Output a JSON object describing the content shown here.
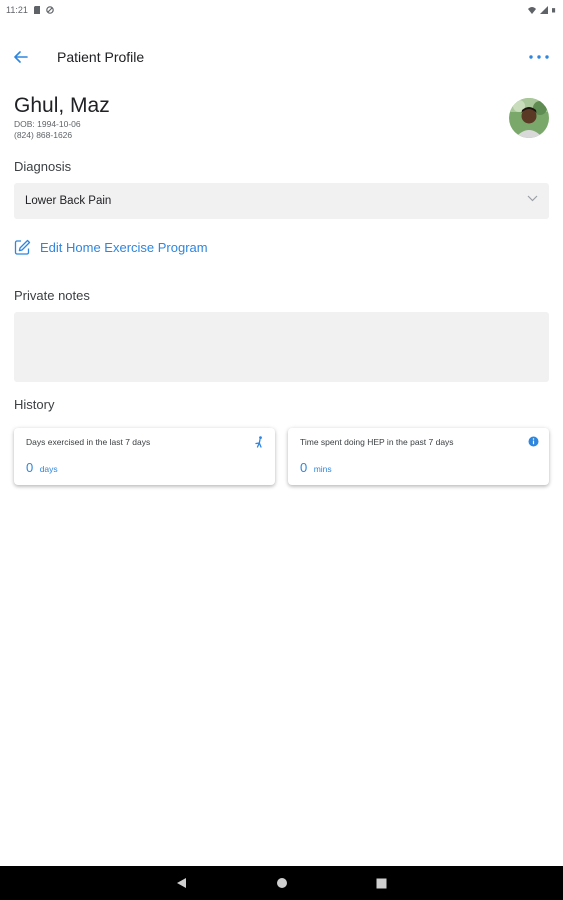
{
  "status_bar": {
    "time": "11:21"
  },
  "app_bar": {
    "title": "Patient Profile",
    "back_icon": "arrow-back-icon",
    "more_icon": "more-horizontal-icon"
  },
  "patient": {
    "name": "Ghul, Maz",
    "dob": "DOB: 1994-10-06",
    "phone": "(824) 868-1626"
  },
  "diagnosis": {
    "label": "Diagnosis",
    "selected": "Lower Back Pain"
  },
  "edit_hep": {
    "label": "Edit Home Exercise Program",
    "icon": "edit-icon"
  },
  "private_notes": {
    "label": "Private notes",
    "value": ""
  },
  "history": {
    "label": "History",
    "cards": [
      {
        "title": "Days exercised in the last 7 days",
        "value": "0",
        "unit": "days",
        "icon": "exercise-figure-icon"
      },
      {
        "title": "Time spent doing HEP in the past 7 days",
        "value": "0",
        "unit": "mins",
        "icon": "info-icon"
      }
    ]
  },
  "colors": {
    "accent": "#2e86de",
    "field_bg": "#f1f1f1",
    "nav_bar": "#000000"
  }
}
